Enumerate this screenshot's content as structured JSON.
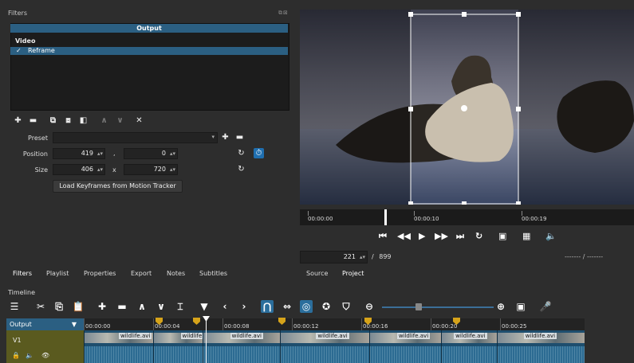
{
  "filters_panel": {
    "title": "Filters",
    "float_icons": "⧉⊠",
    "output_label": "Output",
    "group_label": "Video",
    "active_filter": {
      "check": "✓",
      "label": "Reframe"
    },
    "buttons": {
      "add": "✚",
      "remove": "▬",
      "copy": "⧉",
      "paste": "⧈",
      "save": "◧",
      "deselect": "≡",
      "move_up": "∧",
      "move_down": "∨",
      "close": "✕"
    },
    "preset_label": "Preset",
    "preset_value": "",
    "position_label": "Position",
    "position_x": "419",
    "position_y": "0",
    "position_sep": ",",
    "size_label": "Size",
    "size_w": "406",
    "size_h": "720",
    "size_sep": "x",
    "keyframes_button": "Load Keyframes from Motion Tracker",
    "reset_icon": "↻",
    "keyframe_icon": "⏱",
    "spin_arrows": "▴▾",
    "plus": "✚",
    "minus": "▬",
    "combo_arrow": "▾"
  },
  "left_tabs": [
    "Filters",
    "Playlist",
    "Properties",
    "Export",
    "Notes",
    "Subtitles"
  ],
  "player": {
    "ruler_labels": [
      "00:00:00",
      "00:00:10",
      "00:00:19"
    ],
    "transport": {
      "skip_start": "⏮",
      "rewind": "◀◀",
      "play": "▶",
      "forward": "▶▶",
      "skip_end": "⏭",
      "loop": "↻",
      "fit": "▣",
      "grid": "▦",
      "volume": "🔈"
    },
    "frame": "221",
    "frame_sep": "/",
    "total_frames": "899",
    "in_out": "------- / -------",
    "tabs": [
      "Source",
      "Project"
    ]
  },
  "timeline": {
    "title": "Timeline",
    "toolbar": [
      "☰",
      "✂",
      "⎘",
      "📋",
      "✚",
      "▬",
      "∧",
      "∨",
      "⌶",
      "▼",
      "‹",
      "›",
      "⋂",
      "⇔",
      "◎",
      "✪",
      "⛉",
      "⊖",
      "⊕",
      "▣",
      "🎤"
    ],
    "output_track": "Output",
    "filter_icon": "▼",
    "v1_track": "V1",
    "track_icons": [
      "🔒",
      "🔈",
      "👁"
    ],
    "ruler_labels": [
      "00:00:00",
      "00:00:04",
      "00:00:08",
      "00:00:12",
      "00:00:16",
      "00:00:20",
      "00:00:25"
    ],
    "clips": [
      "wildlife.avi",
      "wildlife",
      "wildlife.avi",
      "wildlife.avi",
      "wildlife.avi",
      "wildlife.avi",
      "wildlife.avi"
    ]
  }
}
